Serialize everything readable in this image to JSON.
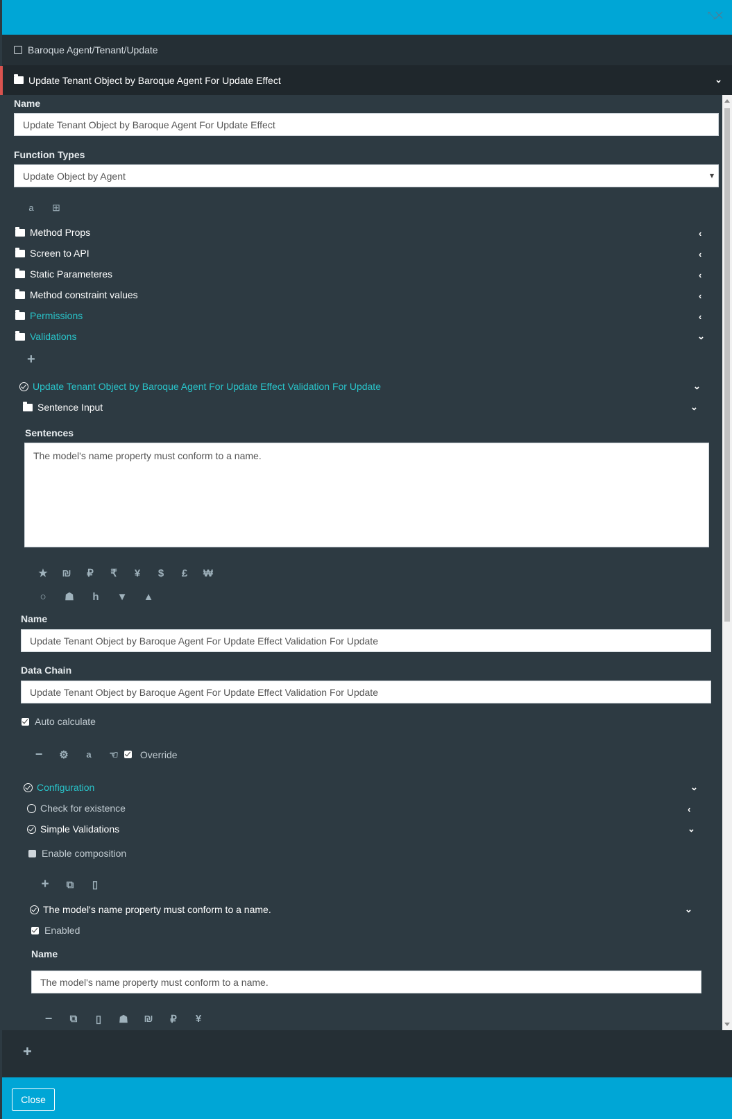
{
  "breadcrumb": {
    "text": "Baroque Agent/Tenant/Update"
  },
  "section": {
    "title": "Update Tenant Object by Baroque Agent For Update Effect"
  },
  "form": {
    "name_label": "Name",
    "name_value": "Update Tenant Object by Baroque Agent For Update Effect",
    "function_types_label": "Function Types",
    "function_types_value": "Update Object by Agent"
  },
  "groups": [
    {
      "label": "Method Props",
      "state": "collapsed"
    },
    {
      "label": "Screen to API",
      "state": "collapsed"
    },
    {
      "label": "Static Parameteres",
      "state": "collapsed"
    },
    {
      "label": "Method constraint values",
      "state": "collapsed"
    },
    {
      "label": "Permissions",
      "state": "collapsed"
    },
    {
      "label": "Validations",
      "state": "expanded"
    }
  ],
  "validation": {
    "title": "Update Tenant Object by Baroque Agent For Update Effect Validation For Update",
    "sentence_input_label": "Sentence Input",
    "sentences_label": "Sentences",
    "sentences_value": "The model's name property must conform to a name.",
    "currency_icons": [
      "★",
      "₪",
      "₽",
      "₹",
      "¥",
      "$",
      "£",
      "₩"
    ],
    "name_label": "Name",
    "name_value": "Update Tenant Object by Baroque Agent For Update Effect Validation For Update",
    "data_chain_label": "Data Chain",
    "data_chain_value": "Update Tenant Object by Baroque Agent For Update Effect Validation For Update",
    "auto_calculate_label": "Auto calculate",
    "override_label": "Override",
    "configuration_label": "Configuration",
    "check_existence_label": "Check for existence",
    "simple_validations_label": "Simple Validations",
    "enable_composition_label": "Enable composition",
    "rule_title": "The model's name property must conform to a name.",
    "enabled_label": "Enabled",
    "rule_name_label": "Name",
    "rule_name_value": "The model's name property must conform to a name.",
    "rule_icons": [
      "₪",
      "₽",
      "¥"
    ]
  },
  "footer": {
    "close_label": "Close"
  },
  "colors": {
    "header": "#00a6d6",
    "panel": "#2d3a42",
    "accent_cyan": "#29c3c9"
  }
}
